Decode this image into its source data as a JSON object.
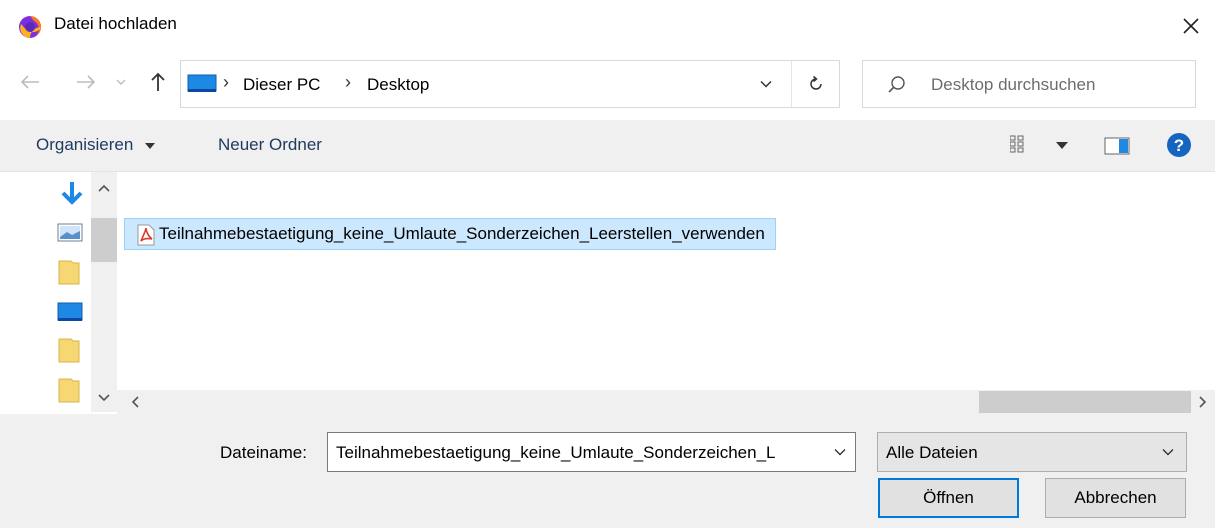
{
  "window": {
    "title": "Datei hochladen",
    "app_icon": "firefox-icon",
    "close_icon": "close-icon"
  },
  "navigation": {
    "back_icon": "arrow-left-icon",
    "forward_icon": "arrow-right-icon",
    "recent_icon": "chevron-down-icon",
    "up_icon": "arrow-up-icon",
    "address": {
      "location_icon": "this-pc-icon",
      "breadcrumbs": [
        "Dieser PC",
        "Desktop"
      ],
      "dropdown_icon": "chevron-down-icon",
      "refresh_icon": "refresh-icon"
    },
    "search": {
      "icon": "search-icon",
      "placeholder": "Desktop durchsuchen"
    }
  },
  "toolbar": {
    "organize_label": "Organisieren",
    "new_folder_label": "Neuer Ordner",
    "view_icon": "view-options-icon",
    "preview_icon": "preview-pane-icon",
    "help_icon": "help-icon"
  },
  "nav_pane": {
    "items": [
      {
        "icon": "downloads-icon"
      },
      {
        "icon": "pictures-icon"
      },
      {
        "icon": "folder-icon"
      },
      {
        "icon": "desktop-icon"
      },
      {
        "icon": "folder-icon"
      },
      {
        "icon": "folder-icon"
      }
    ]
  },
  "files": [
    {
      "name": "Teilnahmebestaetigung_keine_Umlaute_Sonderzeichen_Leerstellen_verwenden",
      "icon": "pdf-icon",
      "selected": true
    }
  ],
  "footer": {
    "filename_label": "Dateiname:",
    "filename_value": "Teilnahmebestaetigung_keine_Umlaute_Sonderzeichen_L",
    "filetype_value": "Alle Dateien",
    "open_label": "Öffnen",
    "cancel_label": "Abbrechen"
  },
  "colors": {
    "selection_bg": "#cce8ff",
    "selection_border": "#99d1ff",
    "accent": "#0078d7",
    "pdf_red": "#d93b2b",
    "folder_yellow": "#f7d774",
    "help_blue": "#1565c0"
  }
}
